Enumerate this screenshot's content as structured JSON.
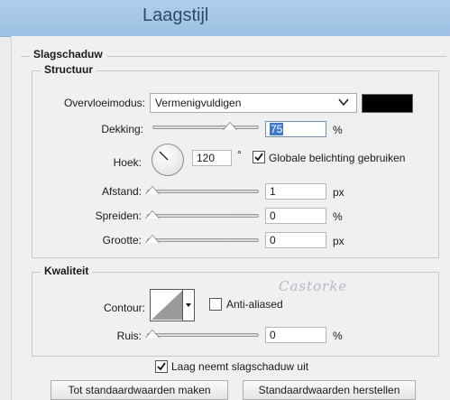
{
  "window": {
    "title": "Laagstijl"
  },
  "shadow": {
    "legend": "Slagschaduw",
    "structure": {
      "legend": "Structuur",
      "blend_mode": {
        "label": "Overvloeimodus:",
        "value": "Vermenigvuldigen",
        "swatch_color": "#000000"
      },
      "opacity": {
        "label": "Dekking:",
        "value": "75",
        "unit": "%",
        "level": 0.75
      },
      "angle": {
        "label": "Hoek:",
        "value": "120",
        "unit": "°",
        "global_light_label": "Globale belichting gebruiken",
        "global_light_checked": true
      },
      "distance": {
        "label": "Afstand:",
        "value": "1",
        "unit": "px"
      },
      "spread": {
        "label": "Spreiden:",
        "value": "0",
        "unit": "%"
      },
      "size": {
        "label": "Grootte:",
        "value": "0",
        "unit": "px"
      }
    },
    "quality": {
      "legend": "Kwaliteit",
      "contour_label": "Contour:",
      "anti_aliased_label": "Anti-aliased",
      "anti_aliased_checked": false,
      "noise": {
        "label": "Ruis:",
        "value": "0",
        "unit": "%"
      },
      "watermark": "Castorke"
    },
    "knockout": {
      "label": "Laag neemt slagschaduw uit",
      "checked": true
    },
    "buttons": {
      "make_default": "Tot standaardwaarden maken",
      "reset_default": "Standaardwaarden herstellen"
    }
  }
}
